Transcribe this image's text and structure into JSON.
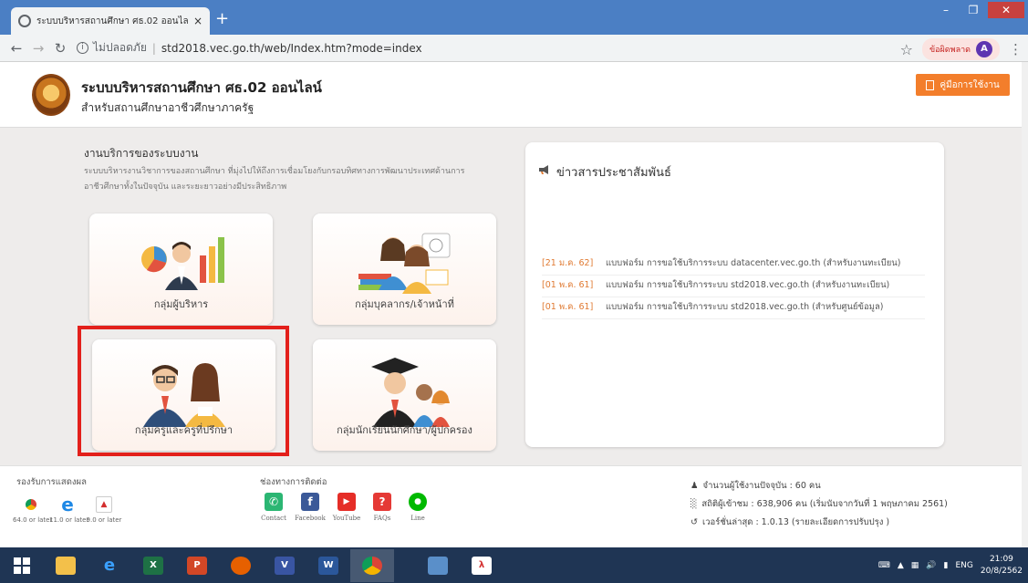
{
  "browser": {
    "tab_title": "ระบบบริหารสถานศึกษา ศธ.02 ออนไล",
    "tab_close": "×",
    "new_tab": "+",
    "security_label": "ไม่ปลอดภัย",
    "url": "std2018.vec.go.th/web/Index.htm?mode=index",
    "error_label": "ข้อผิดพลาด",
    "profile_initial": "A"
  },
  "header": {
    "title": "ระบบบริหารสถานศึกษา ศธ.02 ออนไลน์",
    "subtitle": "สำหรับสถานศึกษาอาชีวศึกษาภาครัฐ",
    "manual_button": "คู่มือการใช้งาน"
  },
  "services": {
    "title": "งานบริการของระบบงาน",
    "description": "ระบบบริหารงานวิชาการของสถานศึกษา ที่มุ่งไปให้ถึงการเชื่อมโยงกับกรอบทิศทางการพัฒนาประเทศด้านการอาชีวศึกษาทั้งในปัจจุบัน และระยะยาวอย่างมีประสิทธิภาพ",
    "cards": [
      {
        "label": "กลุ่มผู้บริหาร"
      },
      {
        "label": "กลุ่มบุคลากร/เจ้าหน้าที่"
      },
      {
        "label": "กลุ่มครูและครูที่ปรึกษา"
      },
      {
        "label": "กลุ่มนักเรียนนักศึกษา/ผู้ปกครอง"
      }
    ]
  },
  "news": {
    "title": "ข่าวสารประชาสัมพันธ์",
    "items": [
      {
        "date": "[21 ม.ค. 62]",
        "text": "แบบฟอร์ม การขอใช้บริการระบบ datacenter.vec.go.th (สำหรับงานทะเบียน)"
      },
      {
        "date": "[01 พ.ค. 61]",
        "text": "แบบฟอร์ม การขอใช้บริการระบบ std2018.vec.go.th (สำหรับงานทะเบียน)"
      },
      {
        "date": "[01 พ.ค. 61]",
        "text": "แบบฟอร์ม การขอใช้บริการระบบ std2018.vec.go.th (สำหรับศูนย์ข้อมูล)"
      }
    ]
  },
  "footer": {
    "supported_title": "รองรับการแสดงผล",
    "browsers": [
      {
        "caption": "64.0 or later",
        "icon": "chrome-icon"
      },
      {
        "caption": "11.0 or later",
        "icon": "ie-icon"
      },
      {
        "caption": "9.0 or later",
        "icon": "pdf-icon"
      }
    ],
    "contact_title": "ช่องทางการติดต่อ",
    "contacts": [
      {
        "caption": "Contact",
        "icon": "phone-icon",
        "color": "#2bb673"
      },
      {
        "caption": "Facebook",
        "icon": "facebook-icon",
        "color": "#3b5998"
      },
      {
        "caption": "YouTube",
        "icon": "youtube-icon",
        "color": "#e52d27"
      },
      {
        "caption": "FAQs",
        "icon": "question-icon",
        "color": "#e53935"
      },
      {
        "caption": "Line",
        "icon": "line-icon",
        "color": "#00b900"
      }
    ],
    "stats": {
      "current_users": "จำนวนผู้ใช้งานปัจจุบัน : 60 คน",
      "visitors": "สถิติผู้เข้าชม : 638,906 คน (เริ่มนับจากวันที่ 1 พฤษภาคม 2561)",
      "version": "เวอร์ชั่นล่าสุด : 1.0.13 (รายละเอียดการปรับปรุง )"
    }
  },
  "taskbar": {
    "language": "ENG",
    "time": "21:09",
    "date": "20/8/2562"
  },
  "colors": {
    "accent": "#f37e2b",
    "highlight": "#e3201b",
    "news_date": "#e07a32"
  }
}
